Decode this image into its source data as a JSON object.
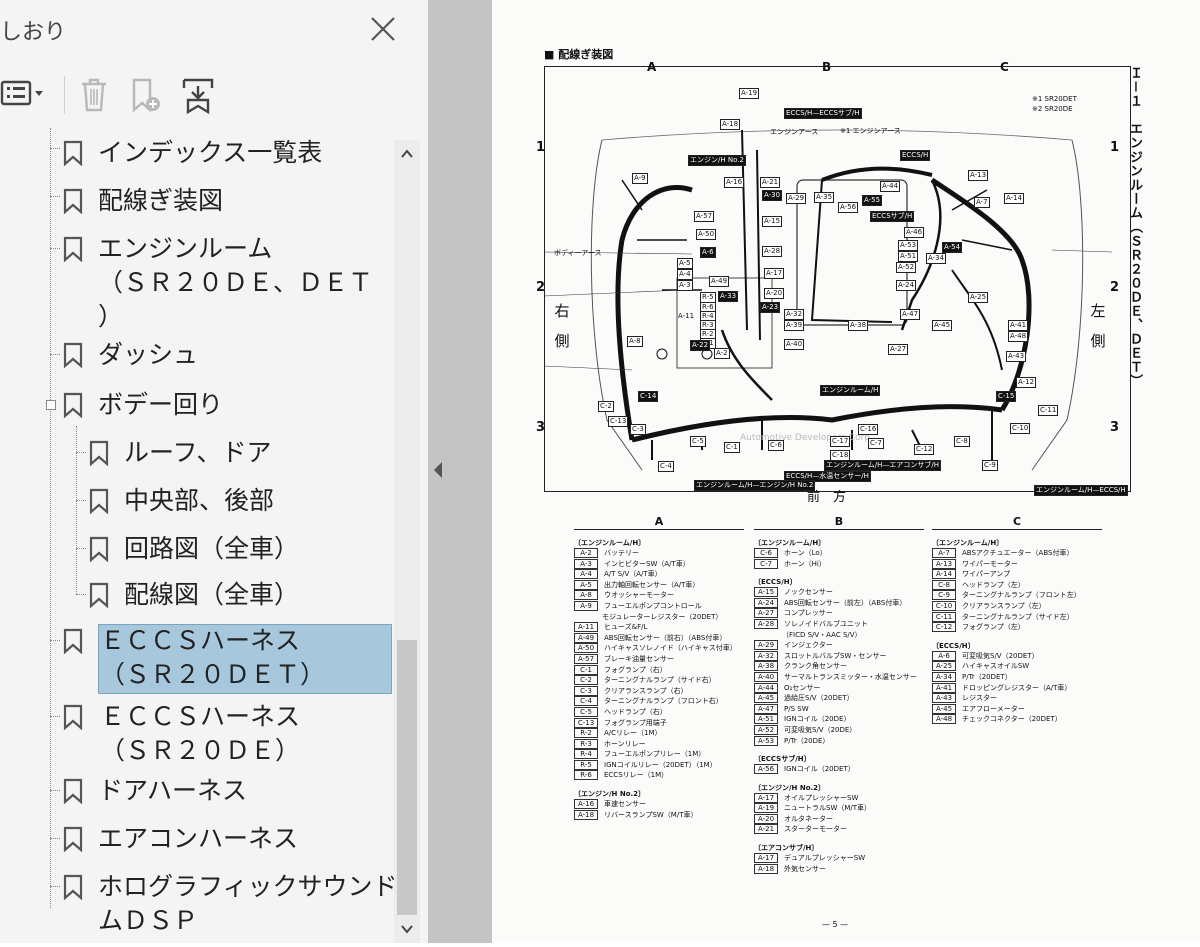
{
  "panel": {
    "title": "しおり",
    "close_icon": "close-icon",
    "toolbar": {
      "options_icon": "options-menu-icon",
      "delete_icon": "trash-icon",
      "add_bookmark_icon": "add-bookmark-icon",
      "find_bookmark_icon": "find-current-bookmark-icon"
    },
    "bookmarks": [
      {
        "label": "インデックス一覧表",
        "level": 0
      },
      {
        "label": "配線ぎ装図",
        "level": 0
      },
      {
        "label": "エンジンルーム\n（ＳＲ２０ＤＥ、ＤＥＴ\n）",
        "level": 0
      },
      {
        "label": "ダッシュ",
        "level": 0
      },
      {
        "label": "ボデー回り",
        "level": 0,
        "expanded": true
      },
      {
        "label": "ルーフ、ドア",
        "level": 1
      },
      {
        "label": "中央部、後部",
        "level": 1
      },
      {
        "label": "回路図（全車）",
        "level": 1
      },
      {
        "label": "配線図（全車）",
        "level": 1
      },
      {
        "label": "ＥＣＣＳハーネス\n（ＳＲ２０ＤＥＴ）",
        "level": 0,
        "selected": true
      },
      {
        "label": "ＥＣＣＳハーネス\n（ＳＲ２０ＤＥ）",
        "level": 0
      },
      {
        "label": "ドアハーネス",
        "level": 0
      },
      {
        "label": "エアコンハーネス",
        "level": 0
      },
      {
        "label": "ホログラフィックサウンドシステ\nムＤＳＰ",
        "level": 0
      }
    ],
    "colors": {
      "selected_bg": "#a7c7dc",
      "panel_bg": "#f4f4f4"
    }
  },
  "document": {
    "title": "■ 配線ぎ装図",
    "columns": [
      "A",
      "B",
      "C"
    ],
    "rows": [
      "1",
      "2",
      "3"
    ],
    "right_side": "左\n側",
    "left_side": "右\n側",
    "front": "前　方",
    "vertical_title": "Ｉ－１　エンジンルーム（ＳＲ２０ＤＥ、ＤＥＴ）",
    "notes": [
      "※1 SR20DET",
      "※2 SR20DE"
    ],
    "watermark": "Automotive Developers Corp",
    "page_number": "— 5 —",
    "diagram_labels": [
      "A-19",
      "A-18",
      "ECCS/H—ECCSサブ/H",
      "エンジンアース",
      "※1 エンジンアース",
      "エンジン/H No.2",
      "ECCS/H",
      "A-9",
      "A-16",
      "A-21",
      "A-30",
      "A-35",
      "A-29",
      "A-55",
      "A-44",
      "A-13",
      "A-7",
      "A-14",
      "A-57",
      "A-15",
      "A-56",
      "ECCSサブ/H",
      "A-46",
      "A-50",
      "A-28",
      "A-54",
      "A-53",
      "A-34",
      "A-52",
      "A-6",
      "ボディーアース",
      "A-5",
      "A-4",
      "A-17",
      "A-51",
      "A-3",
      "A-49",
      "A-20",
      "A-24",
      "A-25",
      "R-5",
      "R-6",
      "R-4",
      "R-3",
      "R-2",
      "R-1",
      "A-33",
      "A-23",
      "A-32",
      "A-39",
      "A-38",
      "A-47",
      "A-45",
      "A-41",
      "A-48",
      "A-11",
      "A-8",
      "A-22",
      "A-2",
      "A-40",
      "A-27",
      "A-43",
      "A-12",
      "エンジンルーム/H",
      "C-14",
      "C-15",
      "C-2",
      "C-13",
      "C-3",
      "C-5",
      "C-4",
      "C-1",
      "C-6",
      "C-17",
      "C-7",
      "C-16",
      "C-18",
      "C-12",
      "C-8",
      "C-10",
      "C-11",
      "C-9",
      "エンジンルーム/H—エアコンサブ/H",
      "ECCS/H—水温センサー/H",
      "エンジンルーム/H—エンジン/H No.2",
      "エンジンルーム/H—ECCS/H"
    ],
    "legend": [
      {
        "column": "A",
        "sections": [
          {
            "name": "〔エンジンルーム/H〕",
            "items": [
              [
                "A-2",
                "バッテリー"
              ],
              [
                "A-3",
                "インヒビターSW（A/T車）"
              ],
              [
                "A-4",
                "A/T S/V（A/T車）"
              ],
              [
                "A-5",
                "出力軸回転センサー（A/T車）"
              ],
              [
                "A-8",
                "ウオッシャーモーター"
              ],
              [
                "A-9",
                "フューエルポンプコントロール"
              ],
              [
                "",
                "モジュレーターレジスター（20DET）"
              ],
              [
                "A-11",
                "ヒューズ&F/L"
              ],
              [
                "A-49",
                "ABS回転センサー（前右）（ABS付車）"
              ],
              [
                "A-50",
                "ハイキャスソレノイド（ハイキャス付車）"
              ],
              [
                "A-57",
                "ブレーキ油量センサー"
              ],
              [
                "C-1",
                "フォグランプ（右）"
              ],
              [
                "C-2",
                "ターニングナルランプ（サイド右）"
              ],
              [
                "C-3",
                "クリアランスランプ（右）"
              ],
              [
                "C-4",
                "ターニングナルランプ（フロント右）"
              ],
              [
                "C-5",
                "ヘッドランプ（右）"
              ],
              [
                "C-13",
                "フォグランプ用端子"
              ],
              [
                "R-2",
                "A/Cリレー（1M）"
              ],
              [
                "R-3",
                "ホーンリレー"
              ],
              [
                "R-4",
                "フューエルポンプリレー（1M）"
              ],
              [
                "R-5",
                "IGNコイルリレー（20DET）（1M）"
              ],
              [
                "R-6",
                "ECCSリレー（1M）"
              ]
            ]
          },
          {
            "name": "〔エンジン/H No.2〕",
            "items": [
              [
                "A-16",
                "車速センサー"
              ],
              [
                "A-18",
                "リバースランプSW（M/T車）"
              ]
            ]
          }
        ]
      },
      {
        "column": "B",
        "sections": [
          {
            "name": "〔エンジンルーム/H〕",
            "items": [
              [
                "C-6",
                "ホーン（Lo）"
              ],
              [
                "C-7",
                "ホーン（Hi）"
              ]
            ]
          },
          {
            "name": "〔ECCS/H〕",
            "items": [
              [
                "A-15",
                "ノックセンサー"
              ],
              [
                "A-24",
                "ABS回転センサー（前左）（ABS付車）"
              ],
              [
                "A-27",
                "コンプレッサー"
              ],
              [
                "A-28",
                "ソレノイドバルブユニット"
              ],
              [
                "",
                "（FICD S/V・AAC S/V）"
              ],
              [
                "A-29",
                "インジェクター"
              ],
              [
                "A-32",
                "スロットルバルブSW・センサー"
              ],
              [
                "A-38",
                "クランク角センサー"
              ],
              [
                "A-40",
                "サーマルトランスミッター・水温センサー"
              ],
              [
                "A-44",
                "O₂センサー"
              ],
              [
                "A-45",
                "過給圧S/V（20DET）"
              ],
              [
                "A-47",
                "P/S SW"
              ],
              [
                "A-51",
                "IGNコイル（20DE）"
              ],
              [
                "A-52",
                "可変吸気S/V（20DE）"
              ],
              [
                "A-53",
                "P/Tr（20DE）"
              ]
            ]
          },
          {
            "name": "〔ECCSサブ/H〕",
            "items": [
              [
                "A-56",
                "IGNコイル（20DET）"
              ]
            ]
          },
          {
            "name": "〔エンジン/H No.2〕",
            "items": [
              [
                "A-17",
                "オイルプレッシャーSW"
              ],
              [
                "A-19",
                "ニュートラルSW（M/T車）"
              ],
              [
                "A-20",
                "オルタネーター"
              ],
              [
                "A-21",
                "スターターモーター"
              ]
            ]
          },
          {
            "name": "〔エアコンサブ/H〕",
            "items": [
              [
                "A-17",
                "デュアルプレッシャーSW"
              ],
              [
                "A-18",
                "外気センサー"
              ]
            ]
          }
        ]
      },
      {
        "column": "C",
        "sections": [
          {
            "name": "〔エンジンルーム/H〕",
            "items": [
              [
                "A-7",
                "ABSアクチュエーター（ABS付車）"
              ],
              [
                "A-13",
                "ワイパーモーター"
              ],
              [
                "A-14",
                "ワイパーアンプ"
              ],
              [
                "C-8",
                "ヘッドランプ（左）"
              ],
              [
                "C-9",
                "ターニングナルランプ（フロント左）"
              ],
              [
                "C-10",
                "クリアランスランプ（左）"
              ],
              [
                "C-11",
                "ターニングナルランプ（サイド左）"
              ],
              [
                "C-12",
                "フォグランプ（左）"
              ]
            ]
          },
          {
            "name": "〔ECCS/H〕",
            "items": [
              [
                "A-6",
                "可変吸気S/V（20DET）"
              ],
              [
                "A-25",
                "ハイキャスオイルSW"
              ],
              [
                "A-34",
                "P/Tr（20DET）"
              ],
              [
                "A-41",
                "ドロッピングレジスター（A/T車）"
              ],
              [
                "A-43",
                "レジスター"
              ],
              [
                "A-45",
                "エアフローメーター"
              ],
              [
                "A-48",
                "チェックコネクター（20DET）"
              ]
            ]
          }
        ]
      }
    ]
  }
}
